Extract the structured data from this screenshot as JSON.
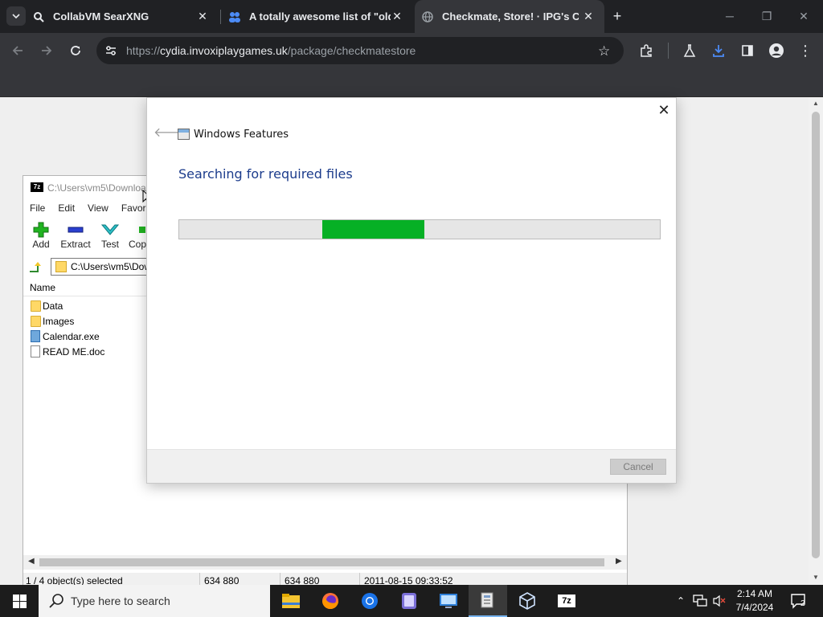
{
  "browser": {
    "tabs": [
      {
        "title": "CollabVM SearXNG"
      },
      {
        "title": "A totally awesome list of \"old \""
      },
      {
        "title": "Checkmate, Store! · IPG's Cydia"
      }
    ],
    "url_scheme": "https://",
    "url_host": "cydia.invoxiplaygames.uk",
    "url_path": "/package/checkmatestore"
  },
  "zip": {
    "logo": "7z",
    "path": "C:\\Users\\vm5\\Downloa",
    "menu": [
      "File",
      "Edit",
      "View",
      "Favorite"
    ],
    "tools": [
      "Add",
      "Extract",
      "Test",
      "Cop"
    ],
    "address": "C:\\Users\\vm5\\Dow",
    "column_name": "Name",
    "files": [
      {
        "name": "Data",
        "type": "folder"
      },
      {
        "name": "Images",
        "type": "folder"
      },
      {
        "name": "Calendar.exe",
        "type": "exe"
      },
      {
        "name": "READ ME.doc",
        "type": "doc"
      }
    ],
    "status": {
      "selected": "1 / 4 object(s) selected",
      "size": "634 880",
      "packed": "634 880",
      "modified": "2011-08-15 09:33:52"
    }
  },
  "dialog": {
    "title": "Windows Features",
    "heading": "Searching for required files",
    "progress_start": 0.298,
    "progress_end": 0.51,
    "cancel_label": "Cancel"
  },
  "taskbar": {
    "search_placeholder": "Type here to search",
    "apps": [
      "file-explorer",
      "firefox",
      "chrome",
      "app-purple",
      "remote-desktop",
      "windows-features",
      "virtualbox",
      "7zip"
    ],
    "time": "2:14 AM",
    "date": "7/4/2024",
    "notifications": "2"
  },
  "colors": {
    "progress": "#06b025",
    "heading": "#1c3c8c",
    "browser_frame": "#202124"
  }
}
